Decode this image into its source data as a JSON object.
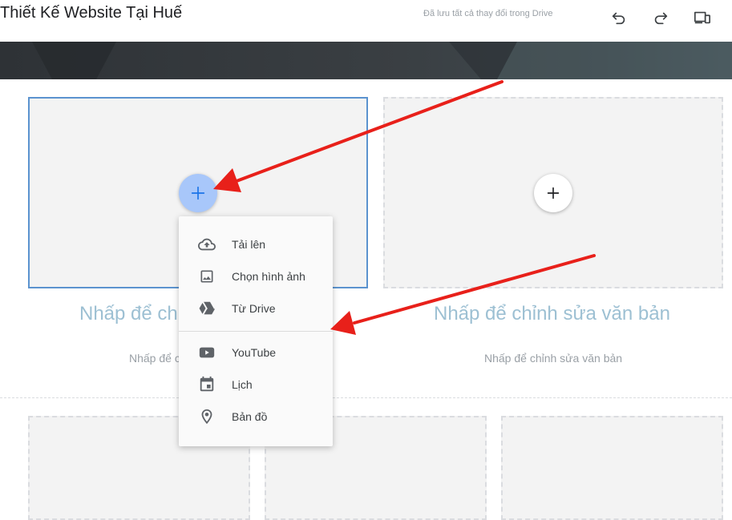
{
  "header": {
    "site_title": "Thiết Kế Website Tại Huế",
    "save_status": "Đã lưu tất cả thay đổi trong Drive",
    "undo_icon": "undo-icon",
    "redo_icon": "redo-icon",
    "preview_icon": "devices-preview-icon"
  },
  "content": {
    "left_heading": "Nhấp để ch",
    "left_body": "Nhấp để c",
    "right_heading": "Nhấp để chỉnh sửa văn bản",
    "right_body": "Nhấp để chỉnh sửa văn bản"
  },
  "insert_menu": {
    "items": [
      {
        "label": "Tải lên",
        "icon": "cloud-upload-icon"
      },
      {
        "label": "Chọn hình ảnh",
        "icon": "image-icon"
      },
      {
        "label": "Từ Drive",
        "icon": "google-drive-icon"
      },
      {
        "label": "YouTube",
        "icon": "youtube-icon"
      },
      {
        "label": "Lịch",
        "icon": "calendar-icon"
      },
      {
        "label": "Bản đồ",
        "icon": "map-pin-icon"
      }
    ]
  },
  "colors": {
    "accent_blue": "#a8c7fa",
    "selected_border": "#5b93cf",
    "annotation_arrow": "#e8201a",
    "banner_dark": "#2e3236"
  }
}
